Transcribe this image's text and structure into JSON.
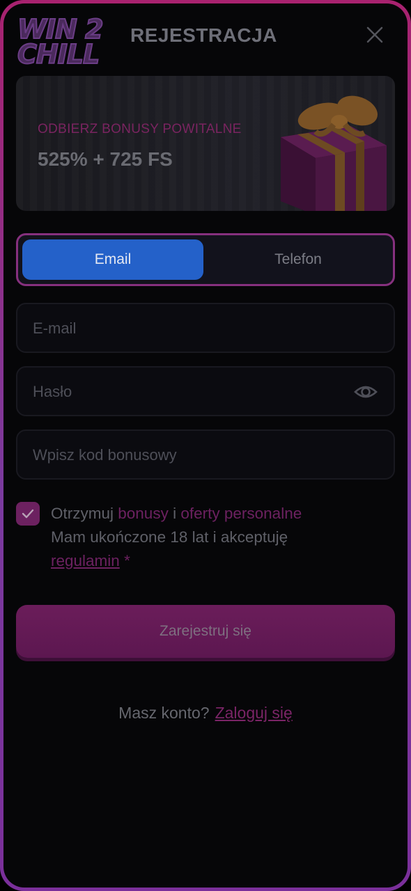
{
  "header": {
    "logo_line1": "WIN 2",
    "logo_line2": "CHILL",
    "title": "REJESTRACJA"
  },
  "banner": {
    "promo": "ODBIERZ BONUSY POWITALNE",
    "amount": "525% + 725 FS"
  },
  "tabs": [
    {
      "label": "Email",
      "active": true
    },
    {
      "label": "Telefon",
      "active": false
    }
  ],
  "form": {
    "email_placeholder": "E-mail",
    "password_placeholder": "Hasło",
    "bonus_placeholder": "Wpisz kod bonusowy"
  },
  "terms": {
    "checked": true,
    "part1": "Otrzymuj",
    "link_bonuses": "bonusy",
    "part2": "i",
    "link_offers": "oferty personalne",
    "part3": "Mam ukończone 18 lat i akceptuję",
    "link_rules": "regulamin",
    "required_mark": "*"
  },
  "submit_label": "Zarejestruj się",
  "login_prompt": {
    "text": "Masz konto?",
    "link": "Zaloguj się"
  },
  "colors": {
    "accent_pink": "#6c2160",
    "tab_active": "#2461c9",
    "frame_gradient_top": "#a8226f",
    "frame_gradient_bottom": "#7a2f9a"
  },
  "icons": [
    "close-icon",
    "eye-icon",
    "checkmark-icon",
    "gift-icon"
  ]
}
